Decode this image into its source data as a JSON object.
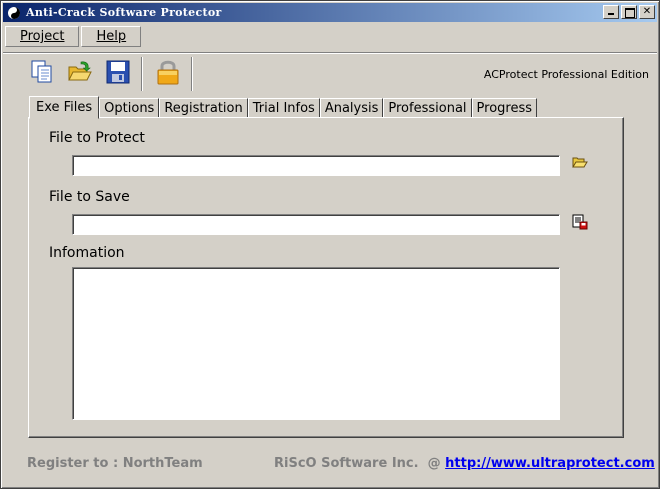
{
  "window": {
    "title": "Anti-Crack Software Protector"
  },
  "menu": [
    {
      "label": "Project"
    },
    {
      "label": "Help"
    }
  ],
  "toolbar": {
    "icons": [
      "copy-icon",
      "open-folder-icon",
      "save-icon",
      "lock-icon"
    ],
    "edition": "ACProtect  Professional Edition"
  },
  "tabs": [
    "Exe Files",
    "Options",
    "Registration",
    "Trial Infos",
    "Analysis",
    "Professional",
    "Progress"
  ],
  "active_tab": "Exe Files",
  "form": {
    "file_to_protect_label": "File to Protect",
    "file_to_protect_value": "",
    "file_to_save_label": "File to Save",
    "file_to_save_value": "",
    "information_label": "Infomation",
    "information_value": ""
  },
  "footer": {
    "register": "Register to : NorthTeam",
    "company": "RiScO Software Inc.  @ ",
    "url": "http://www.ultraprotect.com"
  },
  "colors": {
    "titlebar_start": "#0a246a",
    "titlebar_end": "#a6caf0",
    "face": "#d4d0c8",
    "link": "#0000ee"
  }
}
